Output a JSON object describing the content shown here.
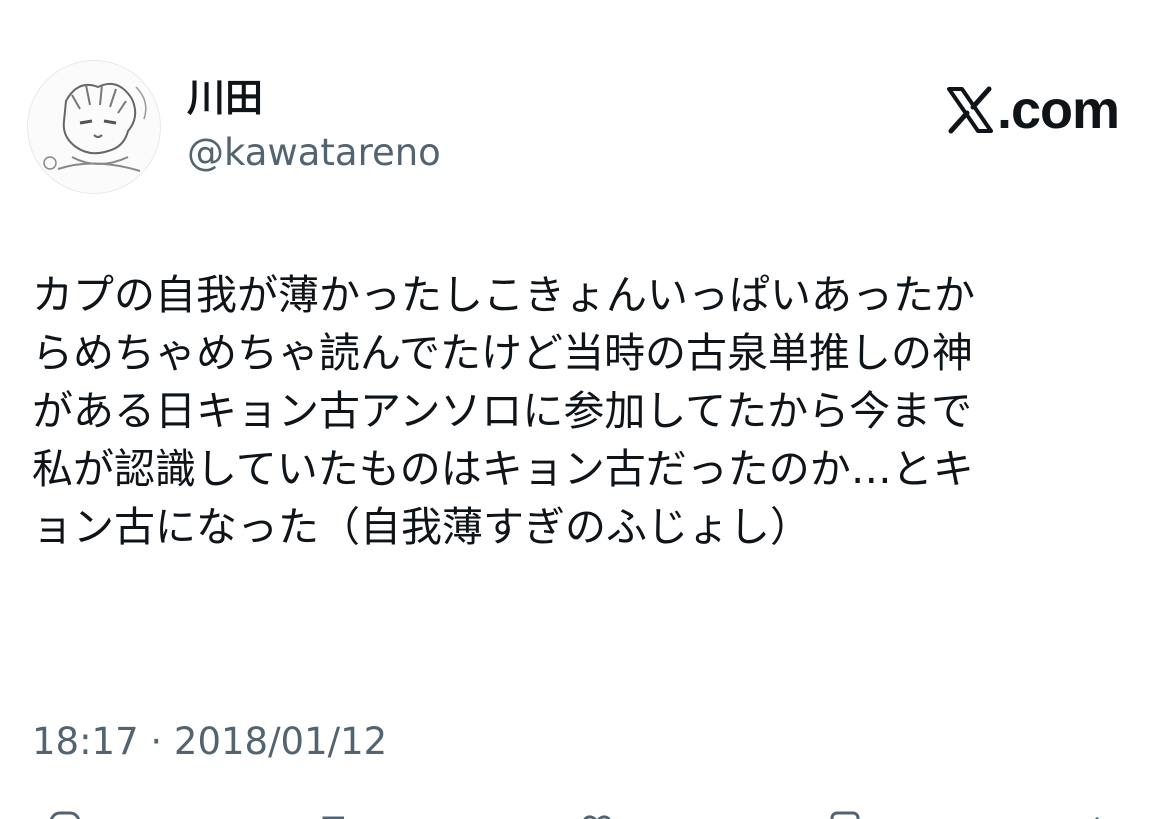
{
  "user": {
    "display_name": "川田",
    "handle": "@kawatareno",
    "avatar_icon": "sketch-avatar-icon"
  },
  "brand": {
    "logo_icon": "x-logo-icon",
    "text": ".com"
  },
  "tweet": {
    "lines": [
      "カプの自我が薄かったしこきょんいっぱいあったか",
      "らめちゃめちゃ読んでたけど当時の古泉単推しの神",
      "がある日キョン古アンソロに参加してたから今まで",
      "私が認識していたものはキョン古だったのか…とキ",
      "ョン古になった（自我薄すぎのふじょし）"
    ]
  },
  "meta": {
    "timestamp": "18:17 · 2018/01/12"
  },
  "actions": [
    {
      "icon": "reply-icon"
    },
    {
      "icon": "retweet-icon"
    },
    {
      "icon": "like-icon"
    },
    {
      "icon": "bookmark-icon"
    },
    {
      "icon": "share-icon"
    }
  ],
  "colors": {
    "text_primary": "#0f1419",
    "text_secondary": "#536471",
    "background": "#ffffff"
  }
}
